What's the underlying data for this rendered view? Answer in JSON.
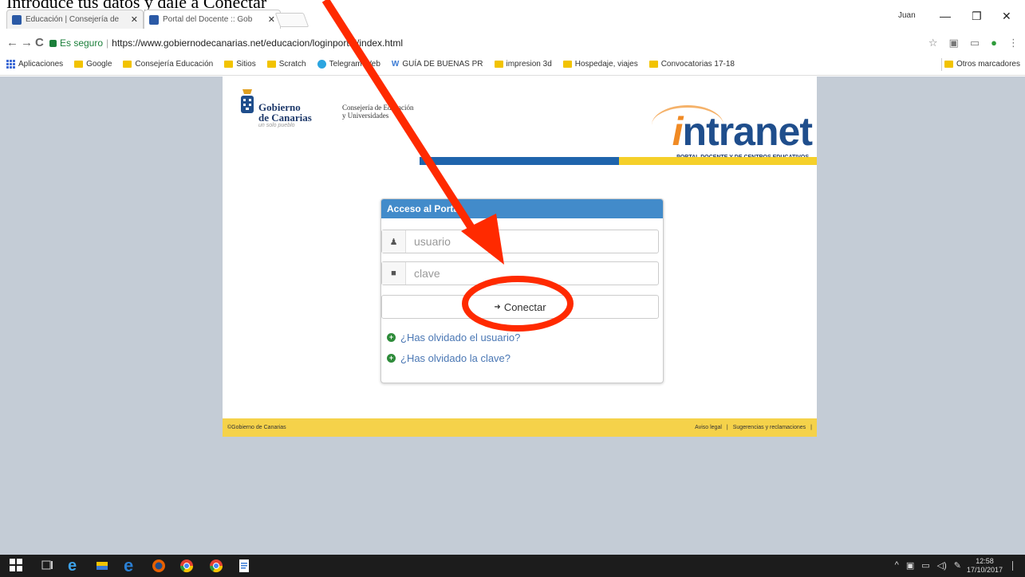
{
  "caption": "Introduce tus datos y dale a Conectar",
  "browser": {
    "tabs": [
      {
        "label": "Educación | Consejería de",
        "active": false
      },
      {
        "label": "Portal del Docente :: Gob",
        "active": true
      }
    ],
    "user": "Juan",
    "window_controls": {
      "minimize": "—",
      "maximize": "❐",
      "close": "✕"
    },
    "nav": {
      "back": "←",
      "forward": "→",
      "reload": "C"
    },
    "secure_label": "Es seguro",
    "url": "https://www.gobiernodecanarias.net/educacion/loginportal/index.html",
    "bookmarks": [
      {
        "label": "Aplicaciones",
        "icon": "apps-icon"
      },
      {
        "label": "Google",
        "icon": "folder-icon"
      },
      {
        "label": "Consejería Educación",
        "icon": "folder-icon"
      },
      {
        "label": "Sitios",
        "icon": "folder-icon"
      },
      {
        "label": "Scratch",
        "icon": "folder-icon"
      },
      {
        "label": "Telegram Web",
        "icon": "telegram-icon"
      },
      {
        "label": "GUÍA DE BUENAS PR",
        "icon": "w-icon"
      },
      {
        "label": "impresion 3d",
        "icon": "folder-icon"
      },
      {
        "label": "Hospedaje, viajes",
        "icon": "folder-icon"
      },
      {
        "label": "Convocatorias 17-18",
        "icon": "folder-icon"
      }
    ],
    "other_bookmarks": "Otros marcadores"
  },
  "page": {
    "gobierno": {
      "line1": "Gobierno",
      "line2": "de Canarias",
      "lema": "un solo pueblo"
    },
    "consejeria": {
      "line1": "Consejería de Educación",
      "line2": "y Universidades"
    },
    "brand": {
      "i": "i",
      "rest": "ntranet",
      "subtitle": "PORTAL DOCENTE Y DE CENTROS EDUCATIVOS"
    },
    "login": {
      "title": "Acceso al Portal",
      "user_placeholder": "usuario",
      "pass_placeholder": "clave",
      "connect_label": "Conectar",
      "forgot_user": "¿Has olvidado el usuario?",
      "forgot_pass": "¿Has olvidado la clave?"
    },
    "footer": {
      "copyright": "©Gobierno de Canarias",
      "links": [
        "Aviso legal",
        "|",
        "Sugerencias y reclamaciones",
        "|"
      ]
    }
  },
  "taskbar": {
    "time": "12:58",
    "date": "17/10/2017"
  },
  "colors": {
    "portal_blue": "#428bca",
    "brand_blue": "#1f4e8c",
    "brand_orange": "#f08a24",
    "stripe_yellow": "#f5d02a",
    "annotation_red": "#ff2a00"
  }
}
